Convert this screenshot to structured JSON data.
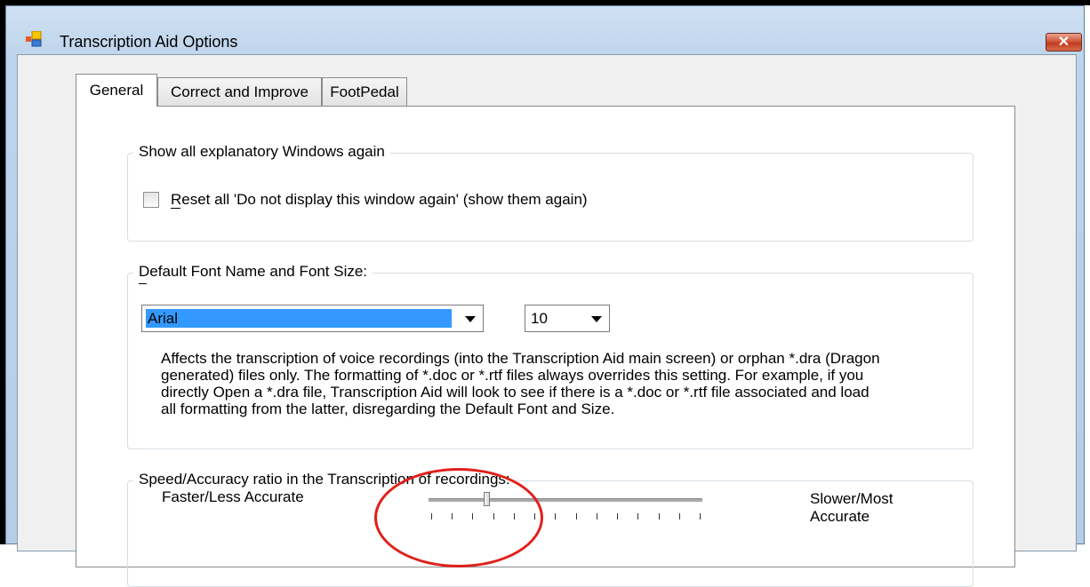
{
  "window": {
    "title": "Transcription Aid Options",
    "close_label": "✕"
  },
  "tabs": [
    {
      "label": "General",
      "selected": true
    },
    {
      "label": "Correct and Improve",
      "selected": false
    },
    {
      "label": "FootPedal",
      "selected": false
    }
  ],
  "general": {
    "explanatory": {
      "title": "Show all explanatory Windows again",
      "reset_checkbox_label": "Reset all 'Do not display this window again' (show them again)",
      "reset_checked": false
    },
    "font": {
      "title": "Default Font Name and Font Size:",
      "font_name": "Arial",
      "font_size": "10",
      "description": [
        "Affects the transcription of voice recordings (into the Transcription Aid main screen) or orphan *.dra (Dragon",
        "generated) files only. The formatting of *.doc or *.rtf files always overrides this setting. For example, if you",
        "directly Open a *.dra file, Transcription Aid will look to see if there is a *.doc or *.rtf file associated and load",
        "all formatting from the latter, disregarding the Default Font and Size."
      ]
    },
    "speed": {
      "title": "Speed/Accuracy ratio in the Transcription of recordings:",
      "left_label": "Faster/Less Accurate",
      "right_label_line1": "Slower/Most",
      "right_label_line2": "Accurate",
      "slider_position": 0.21
    }
  },
  "colors": {
    "selection": "#3399ff",
    "annotation_circle": "#e0201a"
  }
}
